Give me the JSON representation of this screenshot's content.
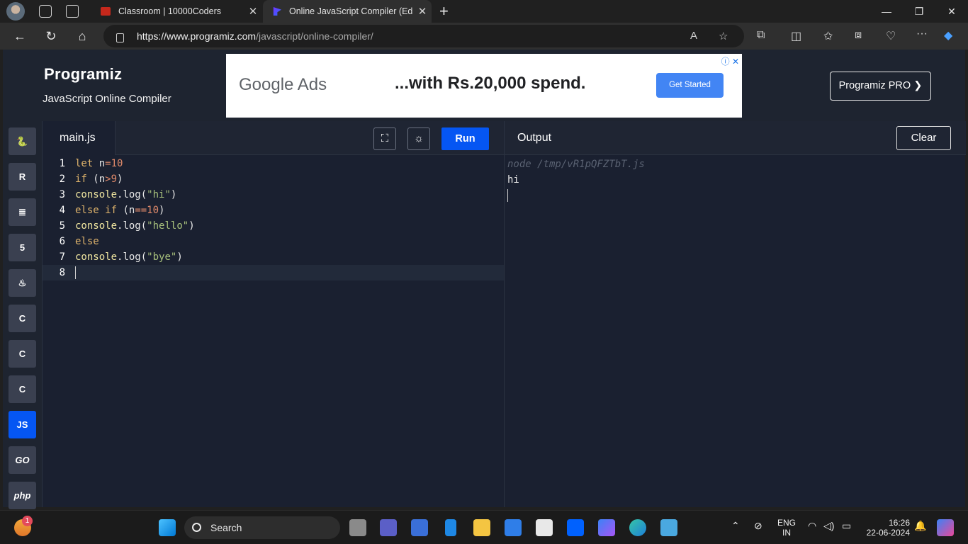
{
  "browser": {
    "tabs": [
      {
        "title": "Classroom | 10000Coders"
      },
      {
        "title": "Online JavaScript Compiler (Edito"
      }
    ],
    "url_domain": "https://www.programiz.com",
    "url_path": "/javascript/online-compiler/"
  },
  "header": {
    "logo": "Programiz",
    "subtitle": "JavaScript Online Compiler",
    "pro_button": "Programiz PRO ❯"
  },
  "ad": {
    "brand": "Google Ads",
    "message": "...with Rs.20,000 spend.",
    "cta": "Get Started"
  },
  "sidebar": {
    "languages": [
      {
        "name": "python-icon",
        "label": "🐍"
      },
      {
        "name": "r-icon",
        "label": "R"
      },
      {
        "name": "sql-icon",
        "label": "≣"
      },
      {
        "name": "html5-icon",
        "label": "5"
      },
      {
        "name": "java-icon",
        "label": "♨"
      },
      {
        "name": "c-icon",
        "label": "C"
      },
      {
        "name": "cpp-icon",
        "label": "C"
      },
      {
        "name": "csharp-icon",
        "label": "C"
      },
      {
        "name": "js-icon",
        "label": "JS"
      },
      {
        "name": "go-icon",
        "label": "GO"
      },
      {
        "name": "php-icon",
        "label": "php"
      }
    ]
  },
  "editor": {
    "filename": "main.js",
    "run_label": "Run",
    "lines": [
      "1",
      "2",
      "3",
      "4",
      "5",
      "6",
      "7",
      "8"
    ]
  },
  "output": {
    "title": "Output",
    "clear_label": "Clear",
    "command": "node /tmp/vR1pQFZTbT.js",
    "result": "hi"
  },
  "taskbar": {
    "search_placeholder": "Search",
    "lang_top": "ENG",
    "lang_bottom": "IN",
    "time": "16:26",
    "date": "22-06-2024",
    "notification_count": "1"
  }
}
